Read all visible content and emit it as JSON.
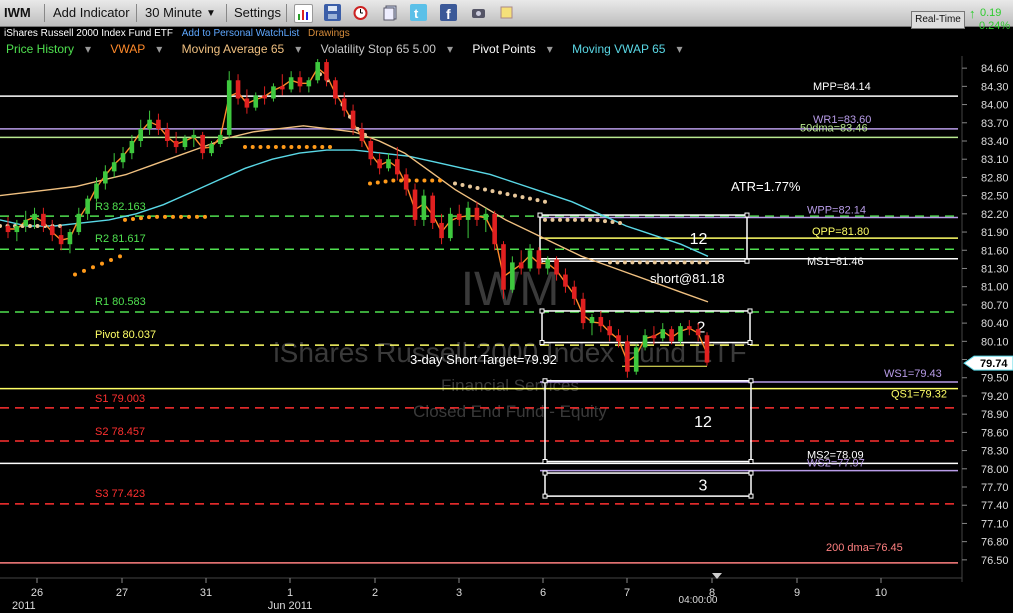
{
  "toolbar": {
    "symbol": "IWM",
    "add_indicator": "Add Indicator",
    "interval": "30 Minute",
    "settings": "Settings",
    "realtime_button": "Real-Time",
    "quote_change": "0.19",
    "quote_pct": "0.24%",
    "icons": [
      "bar-chart-icon",
      "save-icon",
      "alarm-clock-icon",
      "doc-stack-icon",
      "twitter-icon",
      "facebook-icon",
      "camera-icon",
      "note-icon"
    ]
  },
  "title": {
    "name": "iShares Russell 2000 Index Fund ETF",
    "watchlist_link": "Add to Personal WatchList",
    "drawings": "Drawings"
  },
  "indicators": [
    {
      "label": "Price History",
      "color": "#4fe04f"
    },
    {
      "label": "VWAP",
      "color": "#ff8a2a"
    },
    {
      "label": "Moving Average 65",
      "color": "#f0c080"
    },
    {
      "label": "Volatility Stop 65 5.00",
      "color": "#c8c8c8"
    },
    {
      "label": "Pivot Points",
      "color": "#ffffff"
    },
    {
      "label": "Moving VWAP 65",
      "color": "#5ad8e6"
    }
  ],
  "watermark": {
    "symbol": "IWM",
    "name": "iShares Russell 2000 Index Fund ETF",
    "sector": "Financial Services",
    "category": "Closed End Fund - Equity"
  },
  "chart_data": {
    "type": "candlestick",
    "interval": "30 Minute",
    "y_axis": {
      "ticks": [
        "84.60",
        "84.30",
        "84.00",
        "83.70",
        "83.40",
        "83.10",
        "82.80",
        "82.50",
        "82.20",
        "81.90",
        "81.60",
        "81.30",
        "81.00",
        "80.70",
        "80.40",
        "80.10",
        "79.80",
        "79.50",
        "79.20",
        "78.90",
        "78.60",
        "78.30",
        "78.00",
        "77.70",
        "77.40",
        "77.10",
        "76.80",
        "76.50"
      ],
      "ylim": [
        76.3,
        84.8
      ],
      "current_price": "79.74"
    },
    "x_axis": {
      "ticks": [
        "26",
        "27",
        "31",
        "1",
        "2",
        "3",
        "6",
        "7",
        "8",
        "9",
        "10"
      ],
      "sublabels": [
        "2011",
        "Jun 2011"
      ],
      "time_label": "04:00:00"
    },
    "candles": [
      [
        82.0,
        82.15,
        81.8,
        81.9
      ],
      [
        81.9,
        82.1,
        81.75,
        82.0
      ],
      [
        82.0,
        82.25,
        81.9,
        82.1
      ],
      [
        82.1,
        82.3,
        81.95,
        82.2
      ],
      [
        82.2,
        82.3,
        81.9,
        82.0
      ],
      [
        82.0,
        82.1,
        81.75,
        81.85
      ],
      [
        81.85,
        82.0,
        81.6,
        81.7
      ],
      [
        81.7,
        81.95,
        81.55,
        81.9
      ],
      [
        81.9,
        82.3,
        81.85,
        82.2
      ],
      [
        82.2,
        82.5,
        82.1,
        82.45
      ],
      [
        82.45,
        82.8,
        82.4,
        82.7
      ],
      [
        82.7,
        83.0,
        82.6,
        82.9
      ],
      [
        82.9,
        83.2,
        82.8,
        83.05
      ],
      [
        83.05,
        83.3,
        82.95,
        83.2
      ],
      [
        83.2,
        83.5,
        83.1,
        83.4
      ],
      [
        83.4,
        83.75,
        83.3,
        83.6
      ],
      [
        83.6,
        83.9,
        83.5,
        83.75
      ],
      [
        83.75,
        83.85,
        83.5,
        83.6
      ],
      [
        83.6,
        83.7,
        83.3,
        83.4
      ],
      [
        83.4,
        83.55,
        83.2,
        83.3
      ],
      [
        83.3,
        83.5,
        83.25,
        83.45
      ],
      [
        83.45,
        83.6,
        83.3,
        83.5
      ],
      [
        83.5,
        83.55,
        83.1,
        83.2
      ],
      [
        83.2,
        83.4,
        83.15,
        83.35
      ],
      [
        83.35,
        83.6,
        83.3,
        83.5
      ],
      [
        83.5,
        84.55,
        83.45,
        84.4
      ],
      [
        84.4,
        84.5,
        84.0,
        84.1
      ],
      [
        84.1,
        84.25,
        83.85,
        83.95
      ],
      [
        83.95,
        84.2,
        83.9,
        84.15
      ],
      [
        84.15,
        84.3,
        84.0,
        84.1
      ],
      [
        84.1,
        84.35,
        84.05,
        84.3
      ],
      [
        84.3,
        84.5,
        84.15,
        84.25
      ],
      [
        84.25,
        84.55,
        84.2,
        84.45
      ],
      [
        84.45,
        84.55,
        84.2,
        84.3
      ],
      [
        84.3,
        84.45,
        84.2,
        84.4
      ],
      [
        84.4,
        84.75,
        84.35,
        84.7
      ],
      [
        84.7,
        84.75,
        84.3,
        84.4
      ],
      [
        84.4,
        84.45,
        84.0,
        84.1
      ],
      [
        84.1,
        84.2,
        83.8,
        83.9
      ],
      [
        83.9,
        84.0,
        83.5,
        83.6
      ],
      [
        83.6,
        83.7,
        83.3,
        83.4
      ],
      [
        83.4,
        83.45,
        83.0,
        83.1
      ],
      [
        83.1,
        83.2,
        82.85,
        82.95
      ],
      [
        82.95,
        83.2,
        82.9,
        83.1
      ],
      [
        83.1,
        83.3,
        82.75,
        82.85
      ],
      [
        82.85,
        82.95,
        82.5,
        82.6
      ],
      [
        82.6,
        82.7,
        82.0,
        82.1
      ],
      [
        82.1,
        82.6,
        82.0,
        82.5
      ],
      [
        82.5,
        82.55,
        81.95,
        82.05
      ],
      [
        82.05,
        82.2,
        81.7,
        81.8
      ],
      [
        81.8,
        82.3,
        81.75,
        82.2
      ],
      [
        82.2,
        82.35,
        82.0,
        82.1
      ],
      [
        82.1,
        82.4,
        81.8,
        82.3
      ],
      [
        82.3,
        82.4,
        82.0,
        82.1
      ],
      [
        82.1,
        82.3,
        81.9,
        82.2
      ],
      [
        82.2,
        82.25,
        81.6,
        81.7
      ],
      [
        81.7,
        81.75,
        80.8,
        80.95
      ],
      [
        80.95,
        81.5,
        80.9,
        81.4
      ],
      [
        81.4,
        81.6,
        81.2,
        81.3
      ],
      [
        81.3,
        81.7,
        81.25,
        81.6
      ],
      [
        81.6,
        81.65,
        81.2,
        81.3
      ],
      [
        81.3,
        81.5,
        81.2,
        81.45
      ],
      [
        81.45,
        81.5,
        81.1,
        81.2
      ],
      [
        81.2,
        81.3,
        80.9,
        81.0
      ],
      [
        81.0,
        81.1,
        80.7,
        80.8
      ],
      [
        80.8,
        80.9,
        80.3,
        80.4
      ],
      [
        80.4,
        80.55,
        80.2,
        80.5
      ],
      [
        80.5,
        80.6,
        80.25,
        80.35
      ],
      [
        80.35,
        80.45,
        80.1,
        80.2
      ],
      [
        80.2,
        80.3,
        80.0,
        80.1
      ],
      [
        80.1,
        80.2,
        79.5,
        79.6
      ],
      [
        79.6,
        80.05,
        79.55,
        80.0
      ],
      [
        80.0,
        80.3,
        79.95,
        80.2
      ],
      [
        80.2,
        80.35,
        80.05,
        80.15
      ],
      [
        80.15,
        80.4,
        80.1,
        80.3
      ],
      [
        80.3,
        80.35,
        80.05,
        80.1
      ],
      [
        80.1,
        80.4,
        80.05,
        80.35
      ],
      [
        80.35,
        80.45,
        80.2,
        80.3
      ],
      [
        80.3,
        80.4,
        80.1,
        80.2
      ],
      [
        80.2,
        80.25,
        79.7,
        79.75
      ]
    ],
    "moving_average_65": [
      82.5,
      82.55,
      82.6,
      82.65,
      82.75,
      82.85,
      83.0,
      83.15,
      83.3,
      83.45,
      83.55,
      83.6,
      83.65,
      83.6,
      83.55,
      83.4,
      83.2,
      82.9,
      82.6,
      82.35,
      82.1,
      81.9,
      81.7,
      81.5,
      81.35,
      81.2,
      81.05,
      80.9,
      80.75
    ],
    "moving_vwap_65": [
      82.1,
      82.0,
      82.0,
      82.05,
      82.1,
      82.2,
      82.35,
      82.55,
      82.75,
      82.95,
      83.1,
      83.2,
      83.25,
      83.25,
      83.2,
      83.15,
      83.05,
      82.95,
      82.85,
      82.7,
      82.55,
      82.4,
      82.2,
      82.0,
      81.85,
      81.7,
      81.5
    ],
    "volatility_stop_segments": [
      {
        "color": "#e8c89a",
        "values": [
          82.0,
          82.0,
          82.0,
          82.0
        ]
      },
      {
        "color": "#ff9a1a",
        "values": [
          81.2,
          81.3,
          81.4,
          81.5
        ]
      },
      {
        "color": "#ff9a1a",
        "values": [
          82.1,
          82.15,
          82.15,
          82.15
        ]
      },
      {
        "color": "#ff9a1a",
        "values": [
          83.3,
          83.3,
          83.3,
          83.3
        ]
      },
      {
        "color": "#e8c89a",
        "values": [
          84.5,
          84.4,
          84.2,
          84.0,
          83.8,
          83.6,
          83.5
        ]
      },
      {
        "color": "#ff9a1a",
        "values": [
          82.7,
          82.75,
          82.75,
          82.75
        ]
      },
      {
        "color": "#e8c89a",
        "values": [
          82.7,
          82.6,
          82.5,
          82.4
        ]
      },
      {
        "color": "#e8c89a",
        "values": [
          82.1,
          82.1,
          82.1,
          82.05
        ]
      },
      {
        "color": "#e8c89a",
        "values": [
          81.4,
          81.4,
          81.4,
          81.4
        ]
      }
    ],
    "levels": [
      {
        "label": "MPP=84.14",
        "value": 84.14,
        "color": "#ffffff",
        "style": "solid"
      },
      {
        "label": "WR1=83.60",
        "value": 83.6,
        "color": "#b89ce8",
        "style": "solid"
      },
      {
        "label": "50dma=83.46",
        "value": 83.46,
        "color": "#b8e890",
        "style": "solid"
      },
      {
        "label": "R3 82.163",
        "value": 82.163,
        "color": "#4fe04f",
        "style": "dashed"
      },
      {
        "label": "WPP=82.14",
        "value": 82.14,
        "color": "#b89ce8",
        "style": "solid"
      },
      {
        "label": "QPP=81.80",
        "value": 81.8,
        "color": "#ffff66",
        "style": "solid"
      },
      {
        "label": "R2 81.617",
        "value": 81.617,
        "color": "#4fe04f",
        "style": "dashed"
      },
      {
        "label": "MS1=81.46",
        "value": 81.46,
        "color": "#ffffff",
        "style": "solid"
      },
      {
        "label": "R1 80.583",
        "value": 80.583,
        "color": "#4fe04f",
        "style": "dashed"
      },
      {
        "label": "Pivot 80.037",
        "value": 80.037,
        "color": "#ffff66",
        "style": "dashed"
      },
      {
        "label": "WS1=79.43",
        "value": 79.43,
        "color": "#b89ce8",
        "style": "solid"
      },
      {
        "label": "QS1=79.32",
        "value": 79.32,
        "color": "#ffff66",
        "style": "solid"
      },
      {
        "label": "S1 79.003",
        "value": 79.003,
        "color": "#ff3030",
        "style": "dashed"
      },
      {
        "label": "S2 78.457",
        "value": 78.457,
        "color": "#ff3030",
        "style": "dashed"
      },
      {
        "label": "MS2=78.09",
        "value": 78.09,
        "color": "#ffffff",
        "style": "solid"
      },
      {
        "label": "WS2=77.97",
        "value": 77.97,
        "color": "#b89ce8",
        "style": "solid"
      },
      {
        "label": "S3 77.423",
        "value": 77.423,
        "color": "#ff3030",
        "style": "dashed"
      },
      {
        "label": "200 dma=76.45",
        "value": 76.45,
        "color": "#ff8080",
        "style": "solid"
      }
    ],
    "annotations": [
      {
        "text": "ATR=1.77%",
        "color": "#ffffff"
      },
      {
        "text": "short@81.18",
        "color": "#ffffff"
      },
      {
        "text": "3-day Short Target=79.92",
        "color": "#ffffff"
      }
    ],
    "boxes": [
      {
        "label": "12",
        "y_top": 82.18,
        "y_bottom": 81.42
      },
      {
        "label": "2",
        "y_top": 80.6,
        "y_bottom": 80.08
      },
      {
        "label": "12",
        "y_top": 79.45,
        "y_bottom": 78.12
      },
      {
        "label": "3",
        "y_top": 77.93,
        "y_bottom": 77.55
      }
    ],
    "target_line": {
      "value": 79.92,
      "color": "#ffff66"
    }
  }
}
